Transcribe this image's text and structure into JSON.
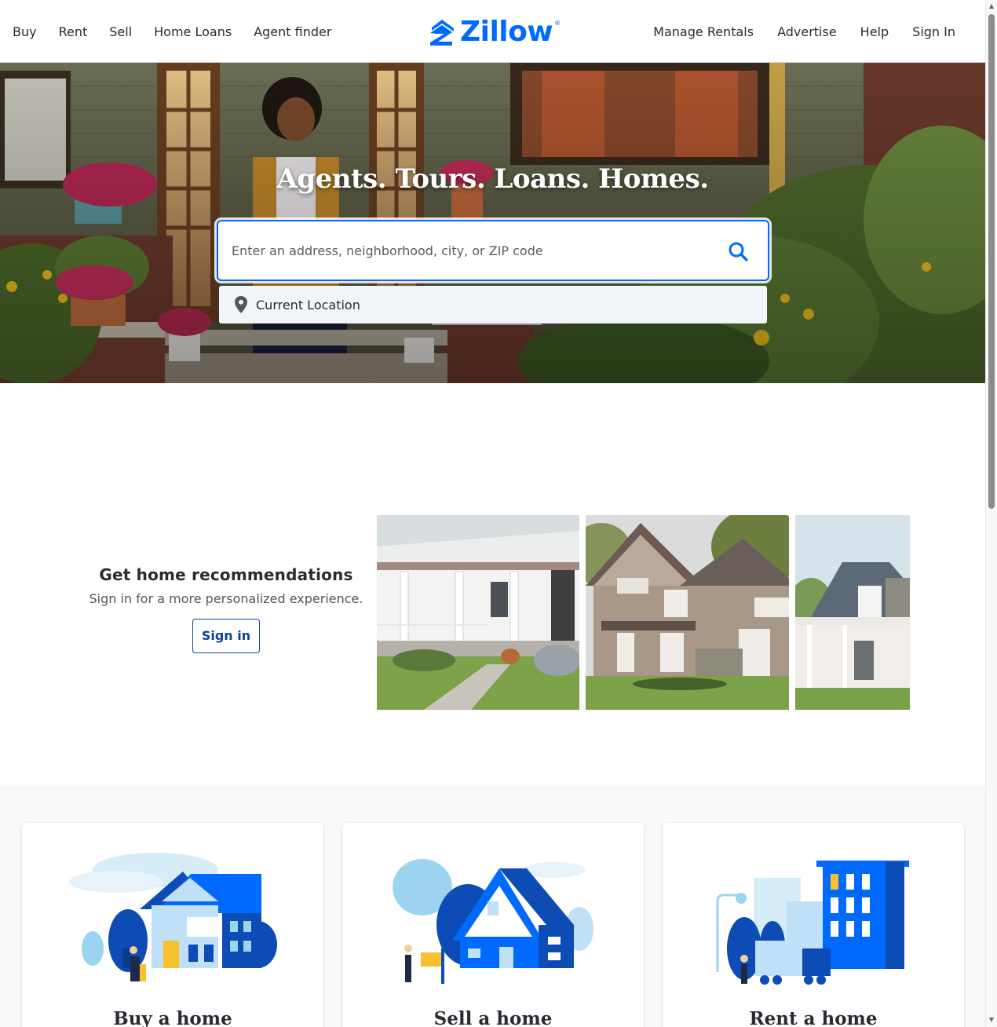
{
  "header": {
    "nav_left": [
      "Buy",
      "Rent",
      "Sell",
      "Home Loans",
      "Agent finder"
    ],
    "nav_right": [
      "Manage Rentals",
      "Advertise",
      "Help",
      "Sign In"
    ],
    "logo_text": "Zillow",
    "logo_reg": "®"
  },
  "hero": {
    "title": "Agents. Tours. Loans. Homes.",
    "search_placeholder": "Enter an address, neighborhood, city, or ZIP code",
    "search_value": "",
    "location_label": "Current Location"
  },
  "recommendations": {
    "title": "Get home recommendations",
    "subtitle": "Sign in for a more personalized experience.",
    "button_label": "Sign in"
  },
  "cards": [
    {
      "title": "Buy a home"
    },
    {
      "title": "Sell a home"
    },
    {
      "title": "Rent a home"
    }
  ],
  "colors": {
    "brand": "#006aff",
    "dark_blue": "#0d4599",
    "text": "#2a2a33"
  },
  "icons": [
    "zillow-logo-icon",
    "search-icon",
    "location-pin-icon"
  ]
}
